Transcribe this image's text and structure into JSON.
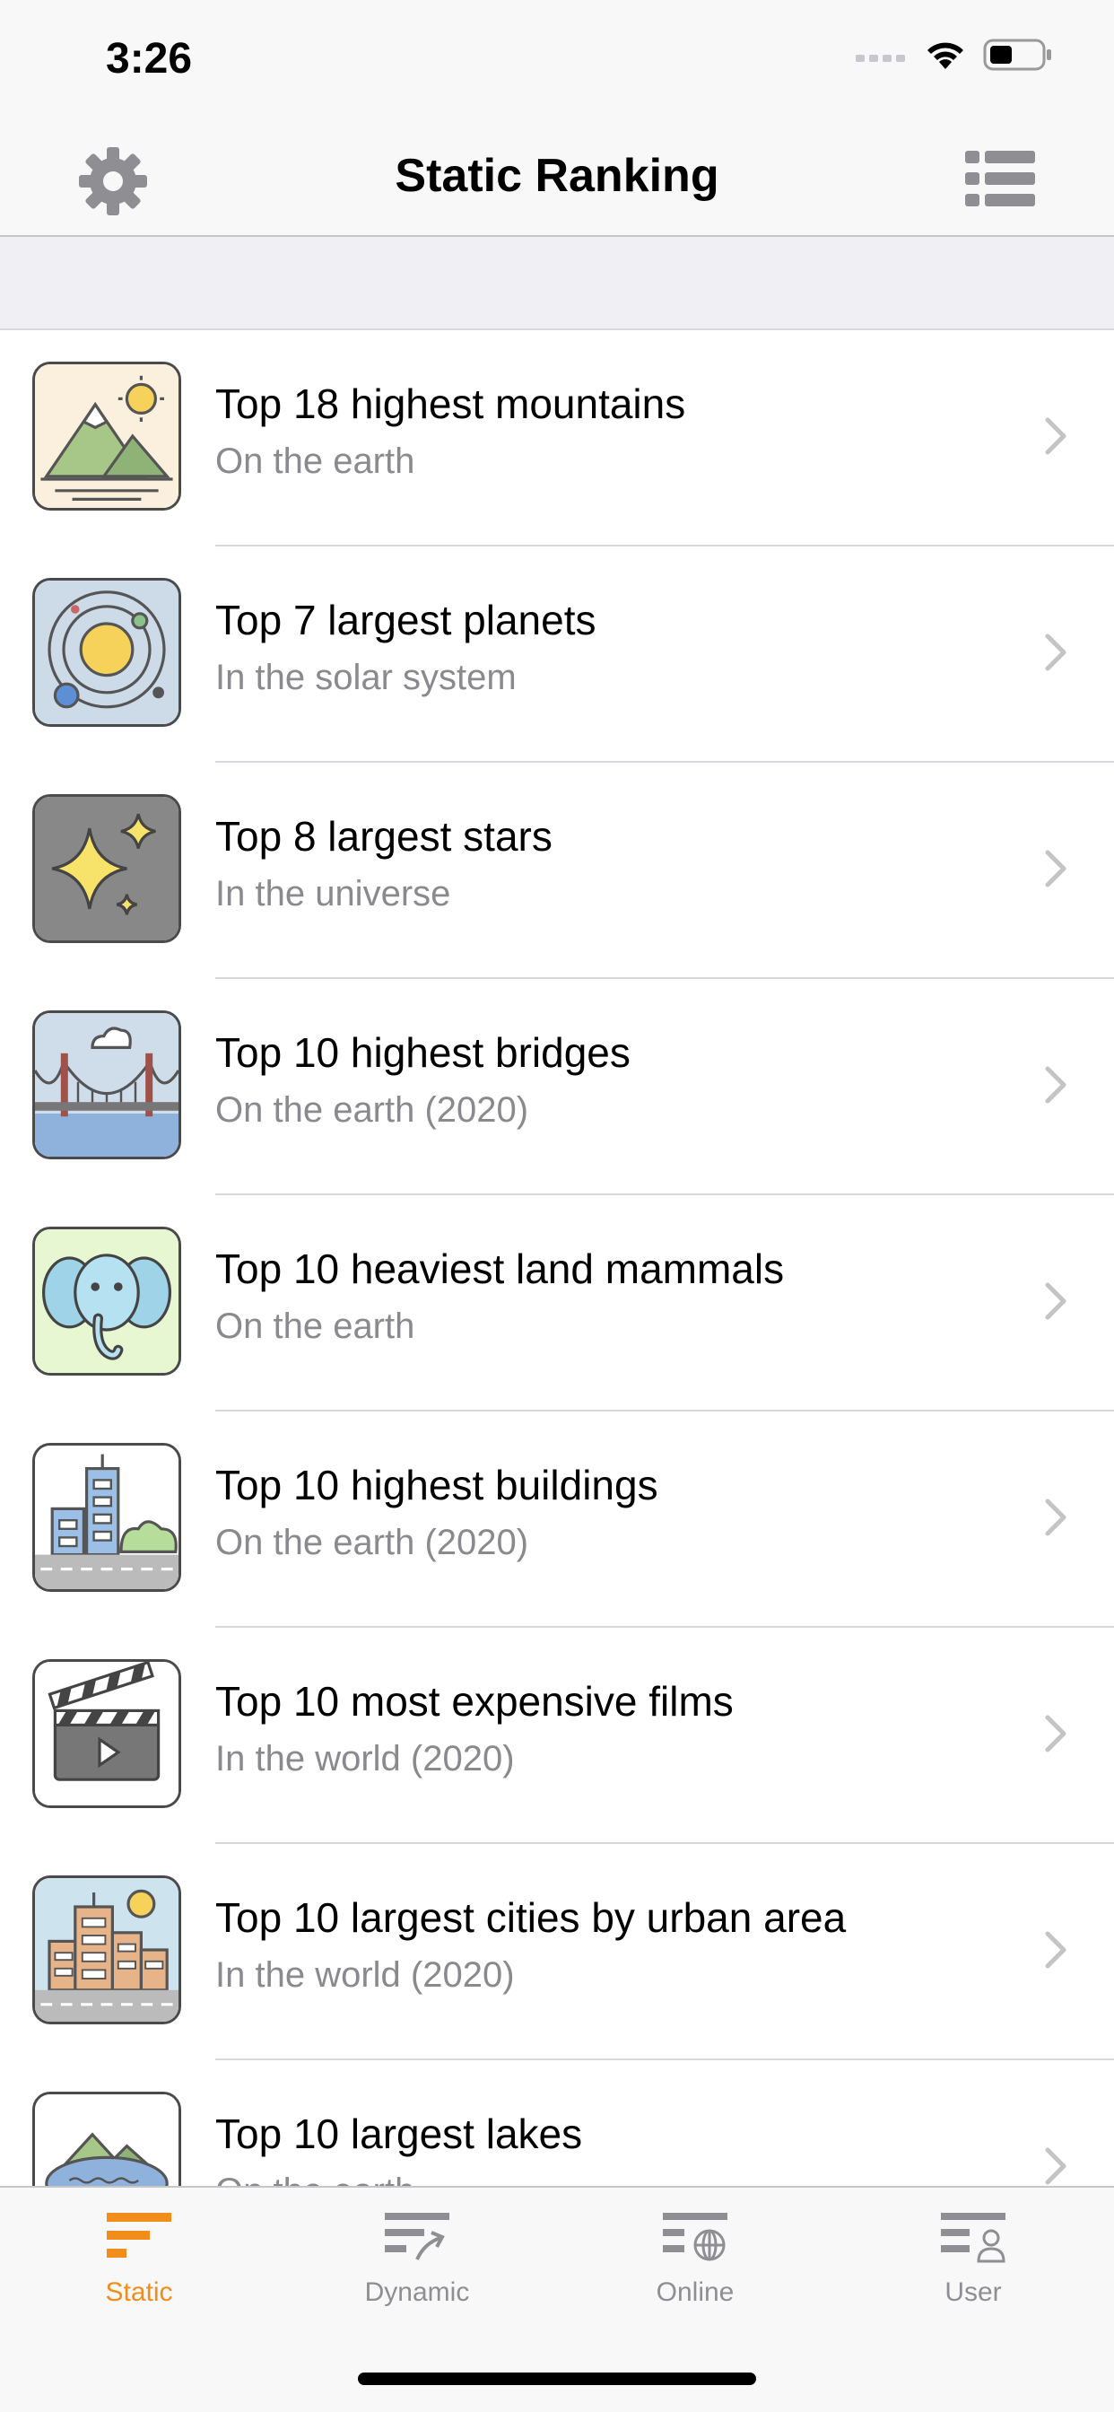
{
  "status": {
    "time": "3:26"
  },
  "nav": {
    "title": "Static Ranking",
    "left_icon": "gear-icon",
    "right_icon": "list-icon"
  },
  "rows": [
    {
      "title": "Top 18 highest mountains",
      "subtitle": "On the earth",
      "icon": "mountain-icon"
    },
    {
      "title": "Top 7 largest planets",
      "subtitle": "In the solar system",
      "icon": "planet-icon"
    },
    {
      "title": "Top 8 largest stars",
      "subtitle": "In the universe",
      "icon": "star-icon"
    },
    {
      "title": "Top 10 highest bridges",
      "subtitle": "On the earth (2020)",
      "icon": "bridge-icon"
    },
    {
      "title": "Top 10 heaviest land mammals",
      "subtitle": "On the earth",
      "icon": "elephant-icon"
    },
    {
      "title": "Top 10 highest buildings",
      "subtitle": "On the earth (2020)",
      "icon": "building-icon"
    },
    {
      "title": "Top 10 most expensive films",
      "subtitle": "In the world (2020)",
      "icon": "clapperboard-icon"
    },
    {
      "title": "Top 10 largest cities by urban area",
      "subtitle": "In the world (2020)",
      "icon": "city-icon"
    },
    {
      "title": "Top 10 largest lakes",
      "subtitle": "On the earth",
      "icon": "lake-icon"
    }
  ],
  "tabs": [
    {
      "label": "Static",
      "active": true,
      "icon": "static-tab-icon"
    },
    {
      "label": "Dynamic",
      "active": false,
      "icon": "dynamic-tab-icon"
    },
    {
      "label": "Online",
      "active": false,
      "icon": "online-tab-icon"
    },
    {
      "label": "User",
      "active": false,
      "icon": "user-tab-icon"
    }
  ],
  "colors": {
    "accent": "#f28c1a",
    "inactive": "#8e8e93",
    "subtitle": "#8a8a8e"
  }
}
